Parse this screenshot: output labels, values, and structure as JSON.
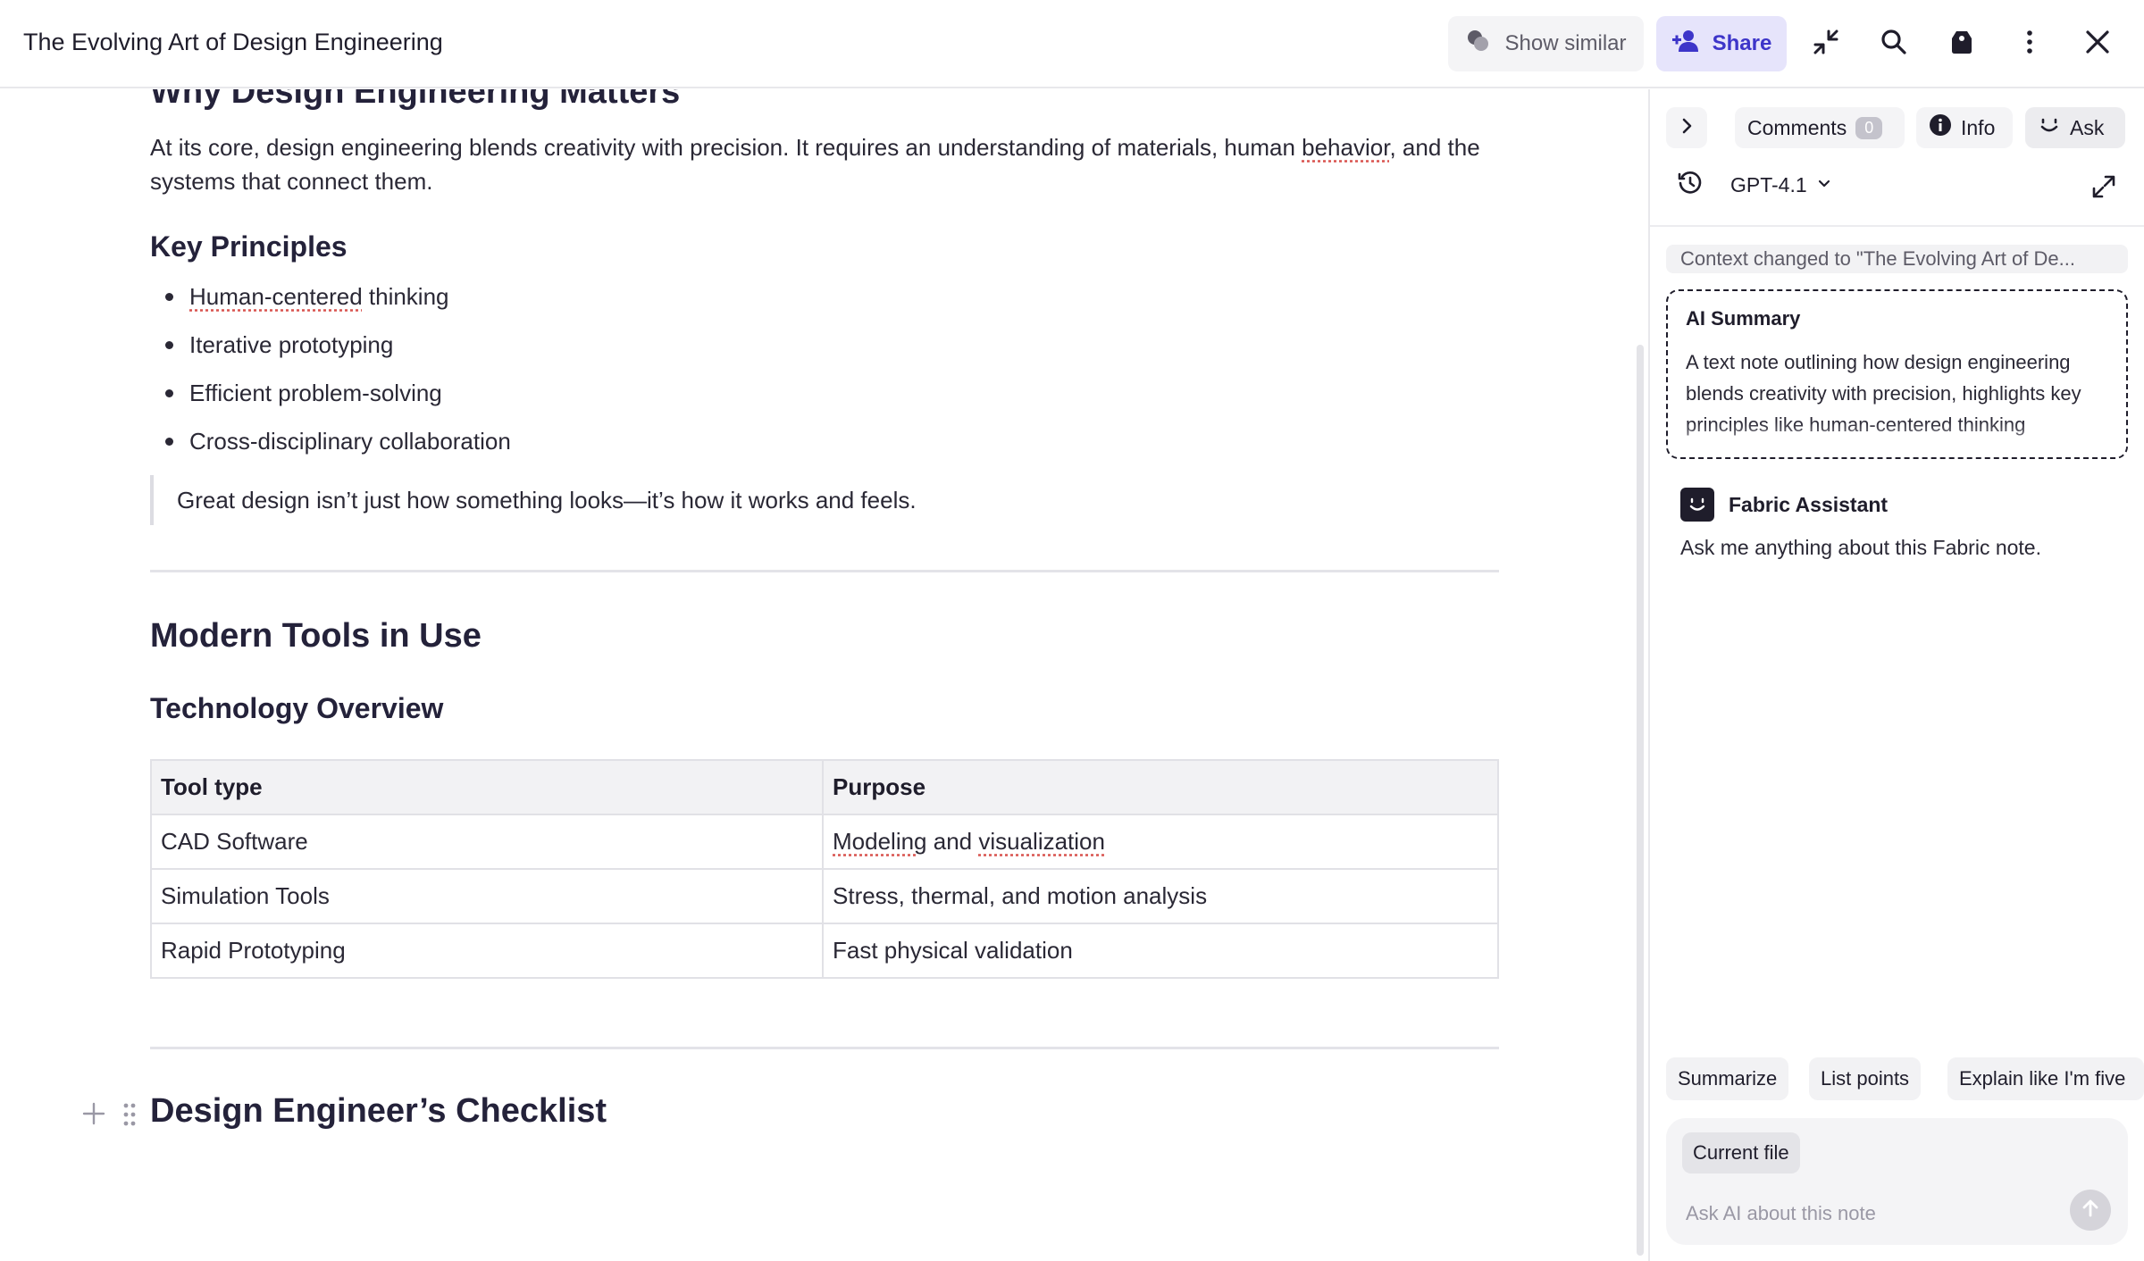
{
  "header": {
    "title": "The Evolving Art of Design Engineering",
    "show_similar_label": "Show similar",
    "share_label": "Share"
  },
  "document": {
    "section_heading_cut": "Why Design Engineering Matters",
    "intro_paragraph": {
      "part1": "At its core, design engineering blends creativity with precision. It requires an understanding of materials, human ",
      "misspelled": "behavior",
      "part2": ", and the systems that connect them."
    },
    "key_principles_heading": "Key Principles",
    "principles": [
      {
        "misspelled": "Human-centered",
        "rest": " thinking"
      },
      {
        "text": "Iterative prototyping"
      },
      {
        "text": "Efficient problem-solving"
      },
      {
        "text": "Cross-disciplinary collaboration"
      }
    ],
    "quote": "Great design isn’t just how something looks—it’s how it works and feels.",
    "tools_heading": "Modern Tools in Use",
    "tech_heading": "Technology Overview",
    "table": {
      "headers": [
        "Tool type",
        "Purpose"
      ],
      "rows": [
        {
          "tool": "CAD Software",
          "purpose_a": "Modeling",
          "purpose_b": " and ",
          "purpose_c": "visualization"
        },
        {
          "tool": "Simulation Tools",
          "purpose": "Stress, thermal, and motion analysis"
        },
        {
          "tool": "Rapid Prototyping",
          "purpose": "Fast physical validation"
        }
      ]
    },
    "checklist_heading": "Design Engineer’s Checklist"
  },
  "panel": {
    "tabs": {
      "comments_label": "Comments",
      "comments_count": "0",
      "info_label": "Info",
      "ask_label": "Ask"
    },
    "model_label": "GPT-4.1",
    "context_chip": "Context changed to \"The Evolving Art of De...",
    "summary": {
      "title": "AI Summary",
      "text": "A text note outlining how design engineering blends creativity with precision, highlights key principles like human-centered thinking"
    },
    "assistant": {
      "name": "Fabric Assistant",
      "message": "Ask me anything about this Fabric note."
    },
    "suggestions": [
      "Summarize",
      "List points",
      "Explain like I'm five"
    ],
    "composer": {
      "file_chip": "Current file",
      "placeholder": "Ask AI about this note"
    }
  },
  "colors": {
    "accent": "#3d35c9",
    "share_bg": "#e6e4fb",
    "text": "#1f1d2b",
    "spellcheck": "#d9534f"
  },
  "icons": [
    "similar-icon",
    "add-user-icon",
    "collapse-icon",
    "search-icon",
    "tag-icon",
    "more-icon",
    "close-icon",
    "chevron-right-icon",
    "info-icon",
    "ask-smile-icon",
    "history-icon",
    "chevron-down-icon",
    "expand-icon",
    "assistant-icon",
    "send-arrow-icon",
    "plus-icon",
    "drag-handle-icon"
  ]
}
